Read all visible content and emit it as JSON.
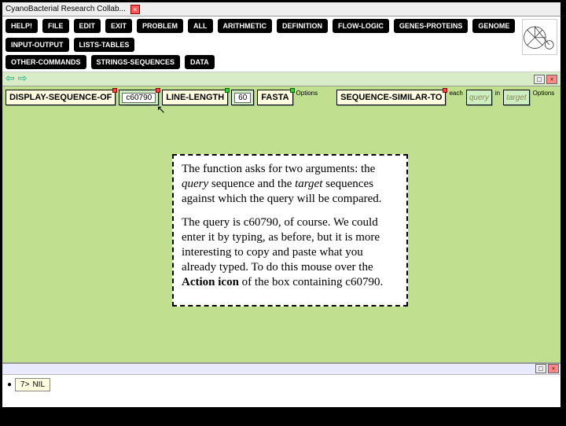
{
  "window": {
    "title": "CyanoBacterial Research Collab..."
  },
  "buttons": {
    "row1": [
      "HELP!",
      "FILE",
      "EDIT",
      "EXIT",
      "PROBLEM",
      "ALL",
      "ARITHMETIC",
      "DEFINITION",
      "FLOW-LOGIC",
      "GENES-PROTEINS",
      "GENOME",
      "INPUT-OUTPUT",
      "LISTS-TABLES"
    ],
    "row2": [
      "OTHER-COMMANDS",
      "STRINGS-SEQUENCES",
      "DATA"
    ]
  },
  "navbar": {
    "end_toggle": "□",
    "end_close": "×"
  },
  "expr1": {
    "box1": "DISPLAY-SEQUENCE-OF",
    "arg1": "c60790",
    "box2": "LINE-LENGTH",
    "arg2": "60",
    "box3": "FASTA",
    "opts": "Options"
  },
  "expr2": {
    "box1": "SEQUENCE-SIMILAR-TO",
    "each": "each",
    "arg1": "query",
    "in": "in",
    "arg2": "target",
    "opts": "Options"
  },
  "info": {
    "p1_a": "The function asks for two arguments: the ",
    "p1_b": "query",
    "p1_c": " sequence and the ",
    "p1_d": "target",
    "p1_e": " sequences against which the query will be compared.",
    "p2_a": "The query is c60790, of course. We could enter it by typing, as before, but it is more interesting to copy and paste what you already typed. To do this mouse over the ",
    "p2_b": "Action icon",
    "p2_c": " of the box containing c60790."
  },
  "console": {
    "prompt": "7>",
    "value": "NIL"
  }
}
